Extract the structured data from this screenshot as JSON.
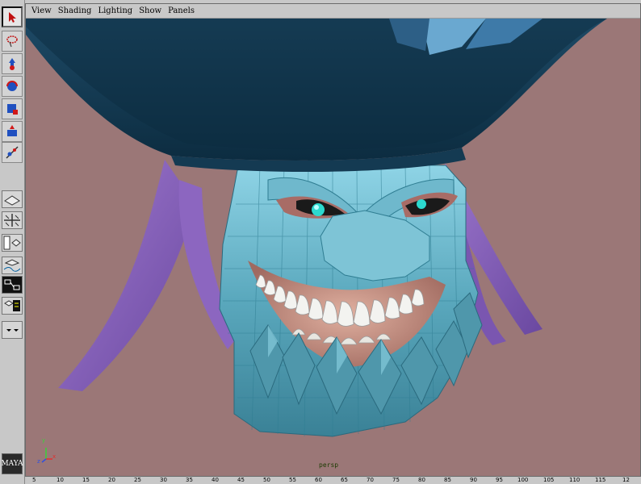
{
  "menu": [
    "View",
    "Shading",
    "Lighting",
    "Show",
    "Panels"
  ],
  "camera_label": "persp",
  "axis": {
    "y": "y",
    "x": "x",
    "z": "z"
  },
  "ruler_ticks": [
    "5",
    "10",
    "15",
    "20",
    "25",
    "30",
    "35",
    "40",
    "45",
    "50",
    "55",
    "60",
    "65",
    "70",
    "75",
    "80",
    "85",
    "90",
    "95",
    "100",
    "105",
    "110",
    "115",
    "12"
  ],
  "tools": [
    "select-tool",
    "lasso-tool",
    "move-tool",
    "rotate-tool",
    "scale-tool",
    "manipulator-tool",
    "last-tool"
  ],
  "layouts": [
    "single-pane",
    "four-pane",
    "outliner-persp",
    "persp-graph",
    "hypergraph",
    "persp-trax",
    "panel-menu"
  ],
  "logo_text": "MAYA"
}
